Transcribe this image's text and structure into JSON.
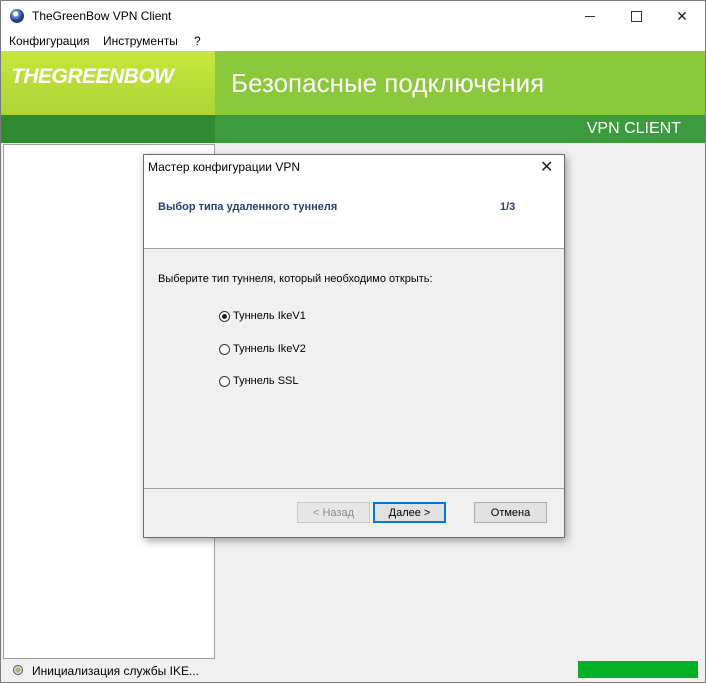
{
  "window": {
    "title": "TheGreenBow VPN Client"
  },
  "menu": [
    "Конфигурация",
    "Инструменты",
    "?"
  ],
  "banner": {
    "logo": "THEGREENBOW",
    "title": "Безопасные подключения",
    "subtitle": "VPN CLIENT"
  },
  "status": {
    "text": "Инициализация службы IKE...",
    "progress": 1.0
  },
  "dialog": {
    "title": "Мастер конфигурации VPN",
    "heading": "Выбор типа удаленного туннеля",
    "step": "1/3",
    "prompt": "Выберите тип туннеля, который необходимо открыть:",
    "options": [
      {
        "label": "Туннель IkeV1",
        "checked": true
      },
      {
        "label": "Туннель IkeV2",
        "checked": false
      },
      {
        "label": "Туннель SSL",
        "checked": false
      }
    ],
    "buttons": {
      "back": "< Назад",
      "next": "Далее >",
      "cancel": "Отмена"
    }
  },
  "colors": {
    "banner_green": "#8cc83c",
    "dark_green": "#3c9b3e",
    "progress": "#06b025"
  }
}
